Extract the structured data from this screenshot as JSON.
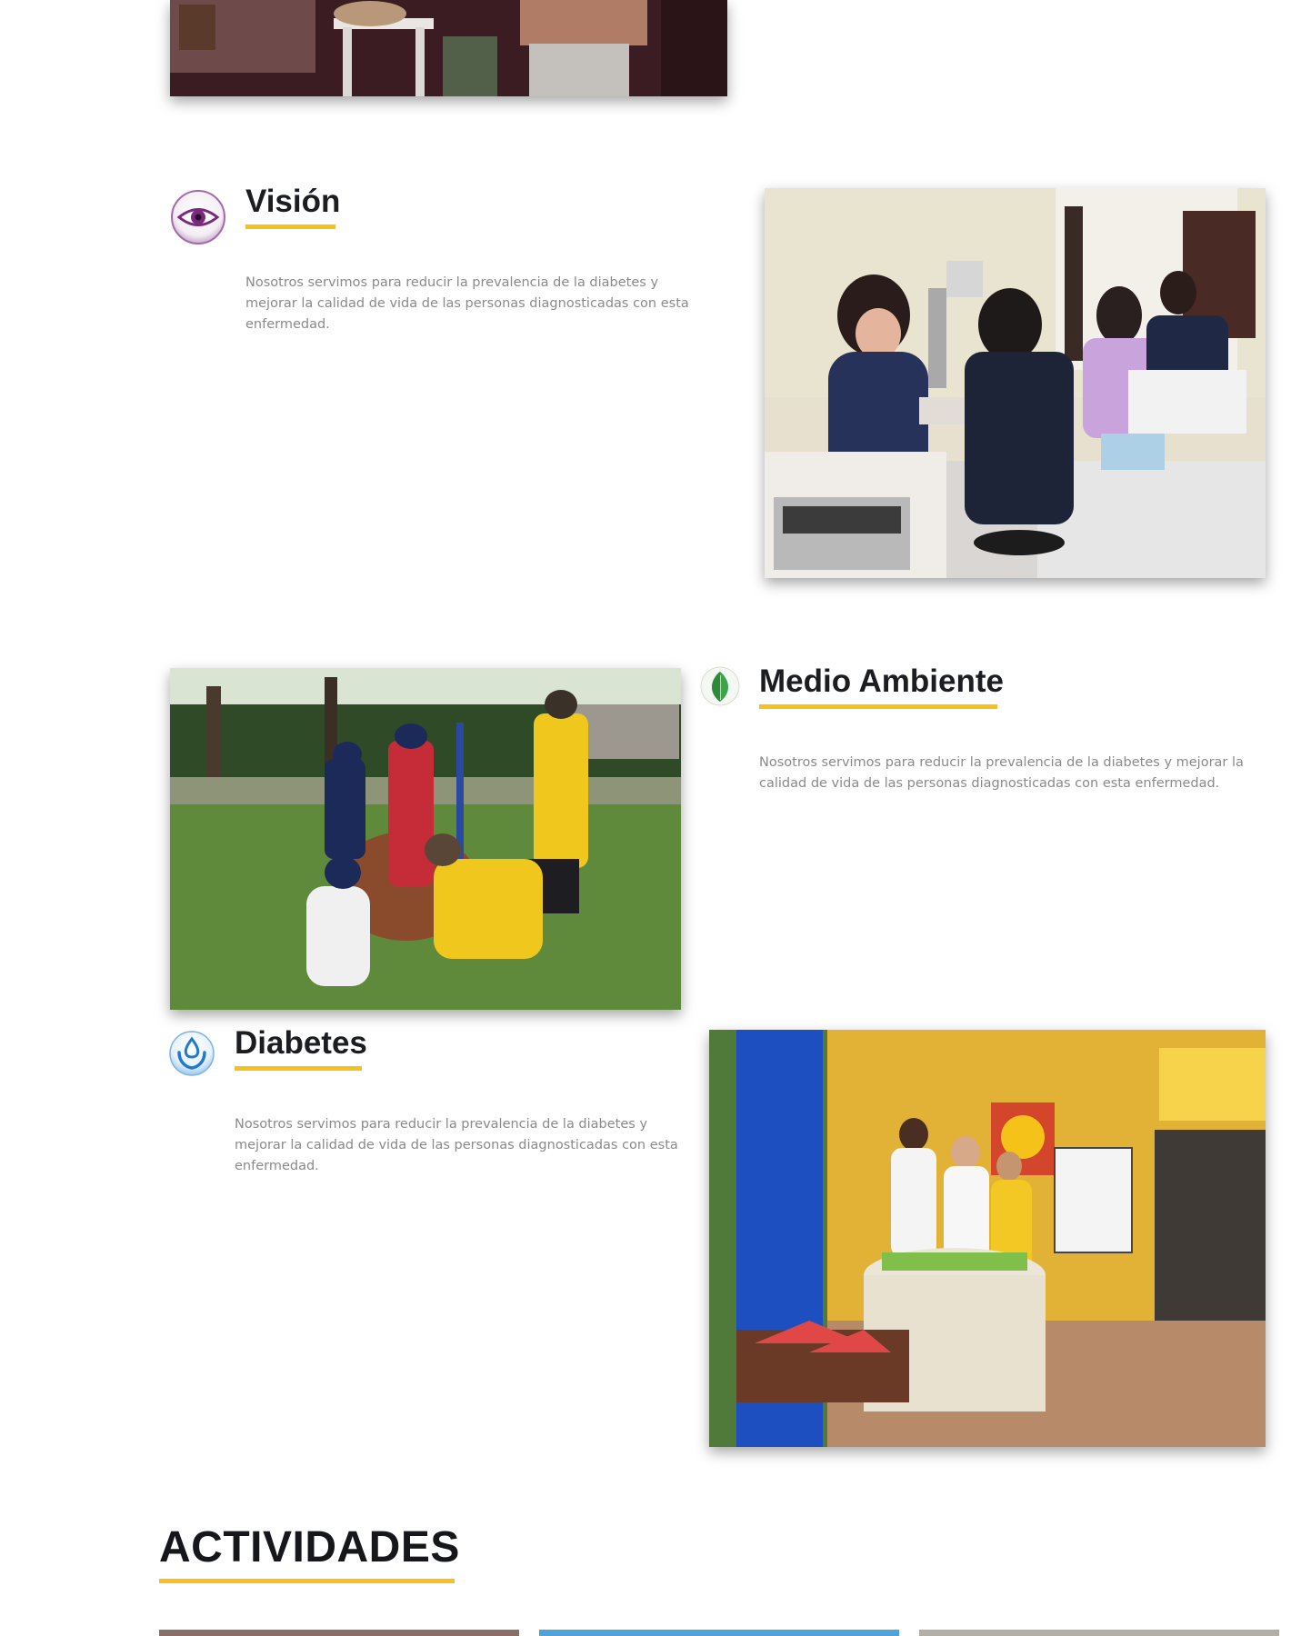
{
  "sections": [
    {
      "key": "vision",
      "title": "Visión",
      "description": "Nosotros servimos para reducir la prevalencia de la diabetes y mejorar la calidad de vida de las personas diagnosticadas con esta enfermedad.",
      "icon": "eye-icon",
      "image": "eye-exam-photo"
    },
    {
      "key": "medio-ambiente",
      "title": "Medio Ambiente",
      "description": "Nosotros servimos para reducir la prevalencia de la diabetes y mejorar la calidad de vida de las personas diagnosticadas con esta enfermedad.",
      "icon": "leaf-icon",
      "image": "tree-planting-photo"
    },
    {
      "key": "diabetes",
      "title": "Diabetes",
      "description": "Nosotros servimos para reducir la prevalencia de la diabetes y mejorar la calidad de vida de las personas diagnosticadas con esta enfermedad.",
      "icon": "hands-drop-icon",
      "image": "diabetes-booth-photo"
    }
  ],
  "activities": {
    "title": "ACTIVIDADES"
  },
  "colors": {
    "accent": "#f6c21a",
    "heading": "#1c1d21",
    "body_text": "#8a8a8a"
  }
}
